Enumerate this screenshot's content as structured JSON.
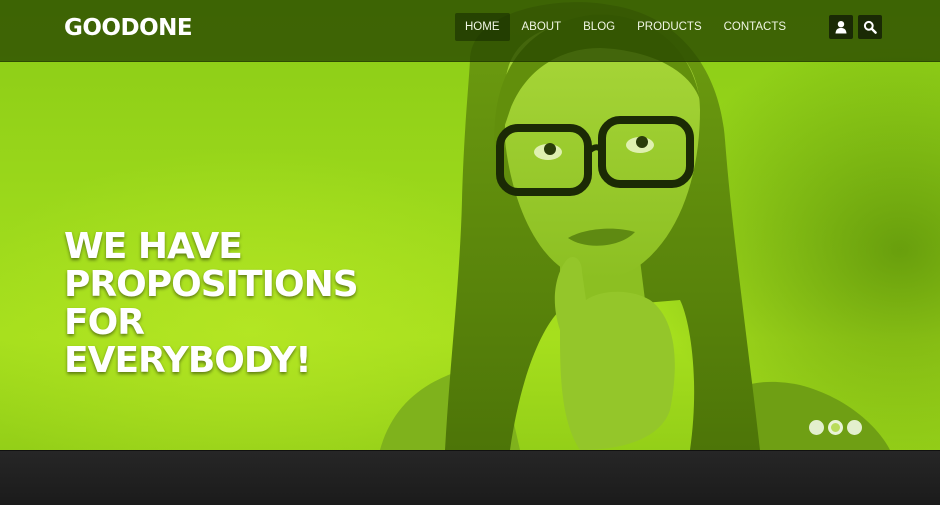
{
  "header": {
    "logo": "GOODONE",
    "nav": [
      {
        "label": "HOME",
        "active": true
      },
      {
        "label": "ABOUT",
        "active": false
      },
      {
        "label": "BLOG",
        "active": false
      },
      {
        "label": "PRODUCTS",
        "active": false
      },
      {
        "label": "CONTACTS",
        "active": false
      }
    ],
    "icons": [
      "user-icon",
      "search-icon"
    ]
  },
  "hero": {
    "headline_lines": [
      "WE HAVE",
      "PROPOSITIONS",
      "FOR",
      "EVERYBODY!"
    ],
    "slides_total": 3,
    "active_slide": 2
  },
  "colors": {
    "accent_green": "#9bd81b",
    "header_bg": "#2c4a06",
    "footer_bg": "#222222"
  }
}
